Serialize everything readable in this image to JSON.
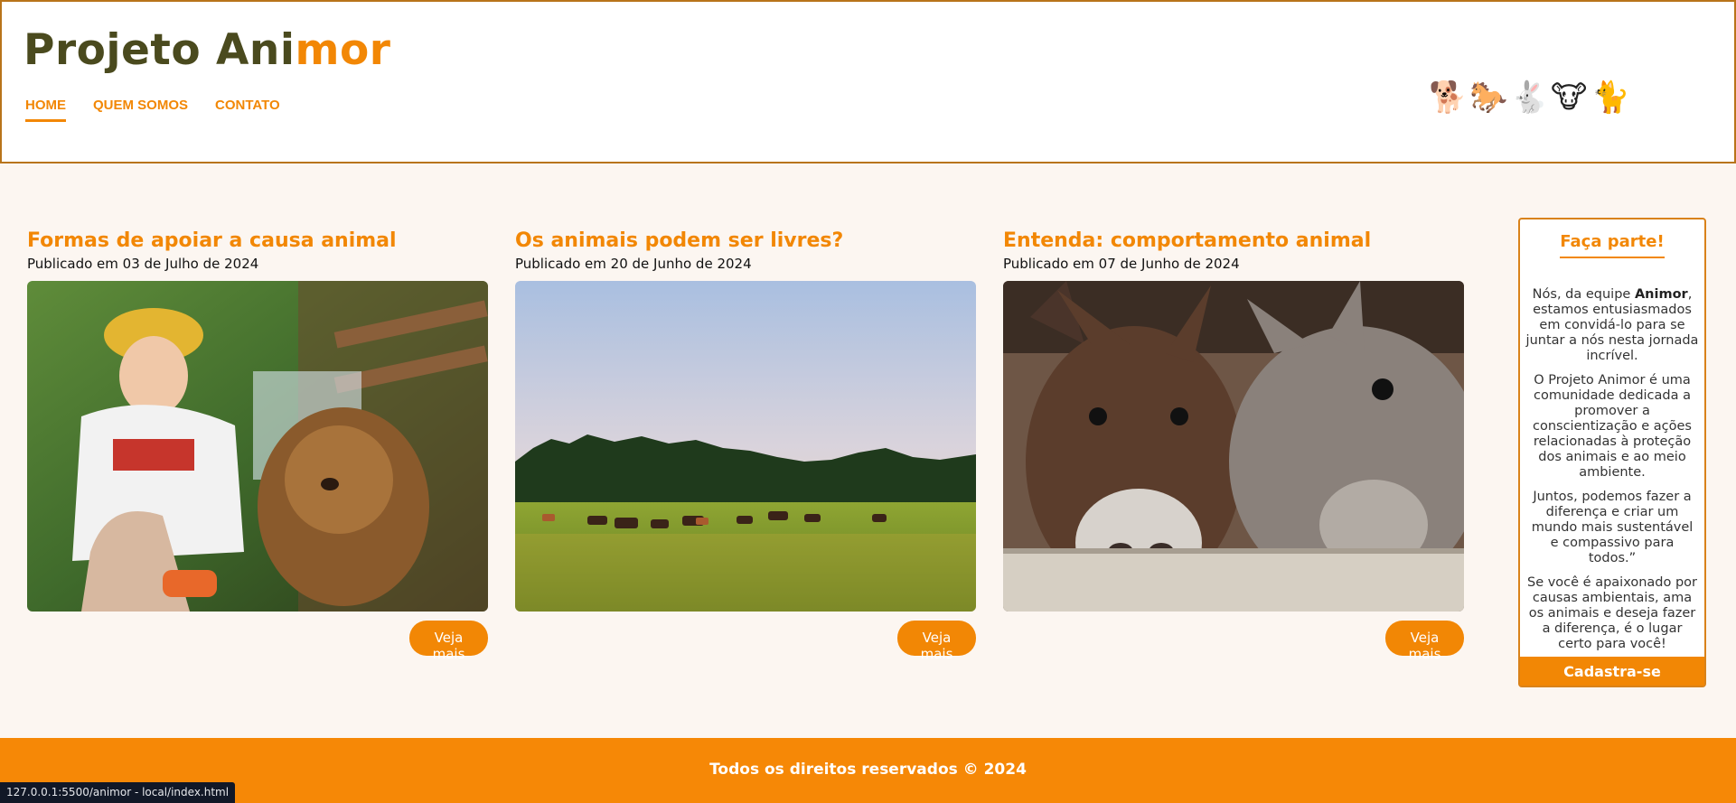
{
  "header": {
    "logo_main": "Projeto Ani",
    "logo_accent": "mor",
    "nav": [
      {
        "label": "HOME"
      },
      {
        "label": "QUEM SOMOS"
      },
      {
        "label": "CONTATO"
      }
    ],
    "animal_icons": [
      "🐕",
      "🐎",
      "🐇",
      "🐮",
      "🐈"
    ]
  },
  "posts": [
    {
      "title": "Formas de apoiar a causa animal",
      "date": "Publicado em 03 de Julho de 2024",
      "button": "Veja mais",
      "image": "child-with-dog-photo"
    },
    {
      "title": "Os animais podem ser livres?",
      "date": "Publicado em 20 de Junho de 2024",
      "button": "Veja mais",
      "image": "cattle-field-photo"
    },
    {
      "title": "Entenda: comportamento animal",
      "date": "Publicado em 07 de Junho de 2024",
      "button": "Veja mais",
      "image": "donkeys-photo"
    }
  ],
  "sidebar": {
    "title": "Faça parte!",
    "p1_before": "Nós, da equipe ",
    "p1_bold": "Animor",
    "p1_after": ", estamos entusiasmados em convidá-lo para se juntar a nós nesta jornada incrível.",
    "p2": "O Projeto Animor é uma comunidade dedicada a promover a conscientização e ações relacionadas à proteção dos animais e ao meio ambiente.",
    "p3": "Juntos, podemos fazer a diferença e criar um mundo mais sustentável e compassivo para todos.”",
    "p4": "Se você é apaixonado por causas ambientais, ama os animais e deseja fazer a diferença, é o lugar certo para você!",
    "button": "Cadastra-se"
  },
  "footer": {
    "text": "Todos os direitos reservados © 2024"
  },
  "statusbar": {
    "url": "127.0.0.1:5500/animor - local/index.html"
  },
  "colors": {
    "accent": "#f28705",
    "footer": "#f68806",
    "background": "#fcf6f1"
  }
}
